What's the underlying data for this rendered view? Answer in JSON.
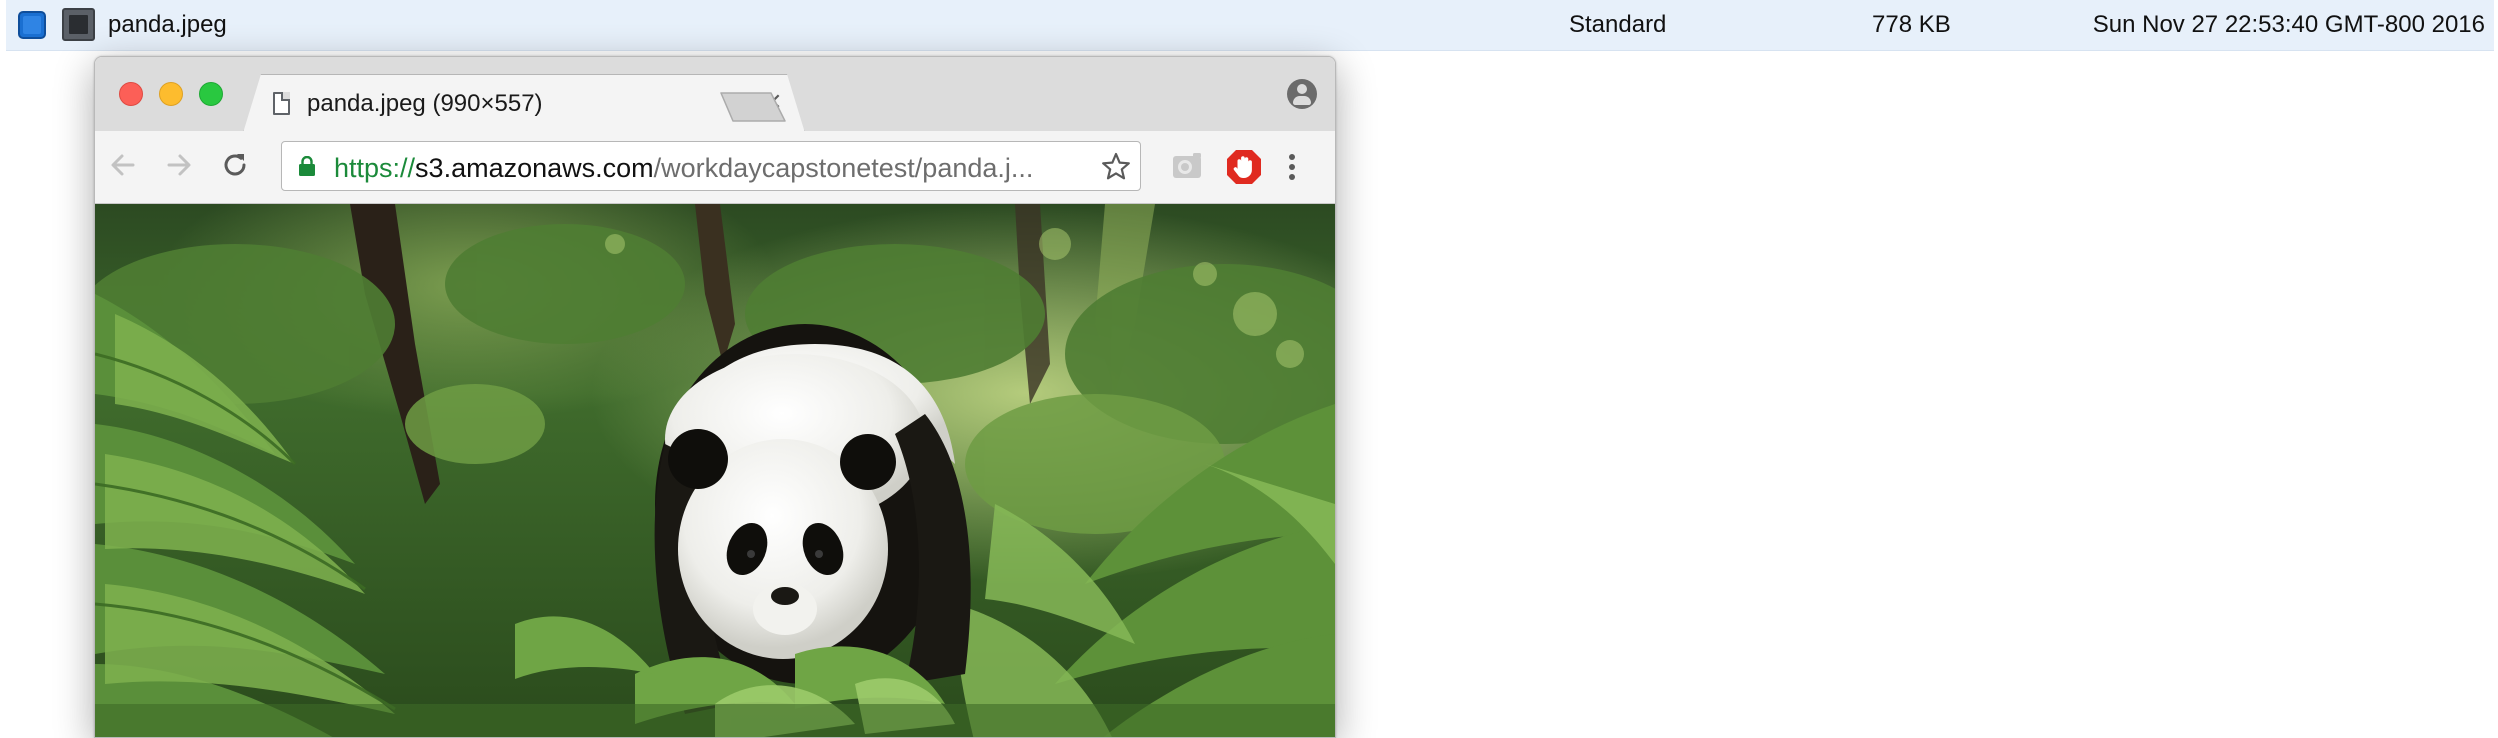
{
  "file_row": {
    "name": "panda.jpeg",
    "storage_class": "Standard",
    "size": "778 KB",
    "last_modified": "Sun Nov 27 22:53:40 GMT-800 2016",
    "selected": true,
    "row_color": "#e7f0fa",
    "checkbox_color": "#1a6fd1"
  },
  "browser": {
    "tab": {
      "title": "panda.jpeg (990×557)",
      "icon": "page-icon",
      "close_icon": "close-icon"
    },
    "toolbar": {
      "icons": [
        "back-arrow-icon",
        "forward-arrow-icon",
        "reload-icon",
        "lock-icon",
        "star-icon",
        "camera-extension-icon",
        "stop-hand-extension-icon",
        "kebab-menu-icon"
      ]
    },
    "url": {
      "scheme": "https://",
      "host": "s3.amazonaws.com",
      "path": "/workdaycapstonetest/panda.j..."
    },
    "content": {
      "image_subject": "giant panda walking through green forest undergrowth"
    },
    "colors": {
      "secure_green": "#1b8a3a",
      "titlebar": "#dcdcdc",
      "toolbar": "#f4f4f4"
    }
  }
}
